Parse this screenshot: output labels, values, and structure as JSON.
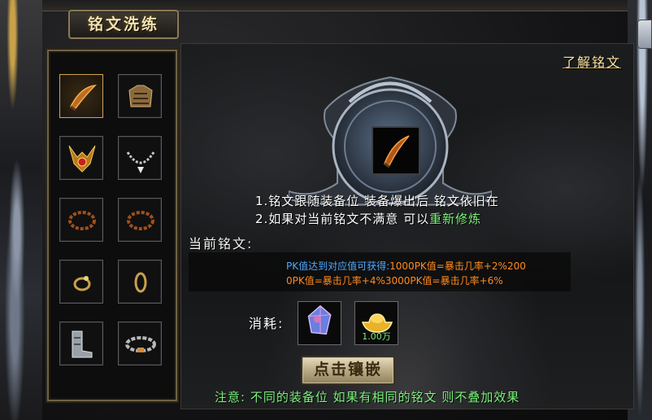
{
  "window": {
    "title": "铭文洗练",
    "learn_link": "了解铭文"
  },
  "equipment_slots": [
    {
      "name": "weapon",
      "icon": "blade-icon",
      "selected": true
    },
    {
      "name": "armor",
      "icon": "armor-icon",
      "selected": false
    },
    {
      "name": "helmet",
      "icon": "helmet-icon",
      "selected": false
    },
    {
      "name": "necklace",
      "icon": "necklace-icon",
      "selected": false
    },
    {
      "name": "bracelet-left",
      "icon": "bracelet-icon",
      "selected": false
    },
    {
      "name": "bracelet-right",
      "icon": "bracelet-icon",
      "selected": false
    },
    {
      "name": "ring-left",
      "icon": "ring-icon",
      "selected": false
    },
    {
      "name": "ring-right",
      "icon": "ring-icon",
      "selected": false
    },
    {
      "name": "boots",
      "icon": "boots-icon",
      "selected": false
    },
    {
      "name": "belt",
      "icon": "belt-icon",
      "selected": false
    }
  ],
  "rules": {
    "line1": "1.铭文跟随装备位 装备爆出后 铭文依旧在",
    "line2_prefix": "2.如果对当前铭文不满意 可以",
    "line2_highlight": "重新修炼"
  },
  "current_inscription": {
    "label": "当前铭文:",
    "line1_blue": "PK值达到对应值可获得:",
    "line1_orange": "1000PK值=暴击几率+2%200",
    "line2_orange": "0PK值=暴击几率+4%3000PK值=暴击几率+6%"
  },
  "cost": {
    "label": "消耗:",
    "items": [
      {
        "icon": "crystal-gem-icon",
        "amount": ""
      },
      {
        "icon": "gold-ingot-icon",
        "amount": "1.00万"
      }
    ]
  },
  "inlay_button": "点击镶嵌",
  "notice": "注意: 不同的装备位 如果有相同的铭文 则不叠加效果",
  "colors": {
    "gold_text": "#f3e2b0",
    "green_text": "#7df27d",
    "blue_text": "#4fa8ff",
    "orange_text": "#ff8a1e"
  }
}
